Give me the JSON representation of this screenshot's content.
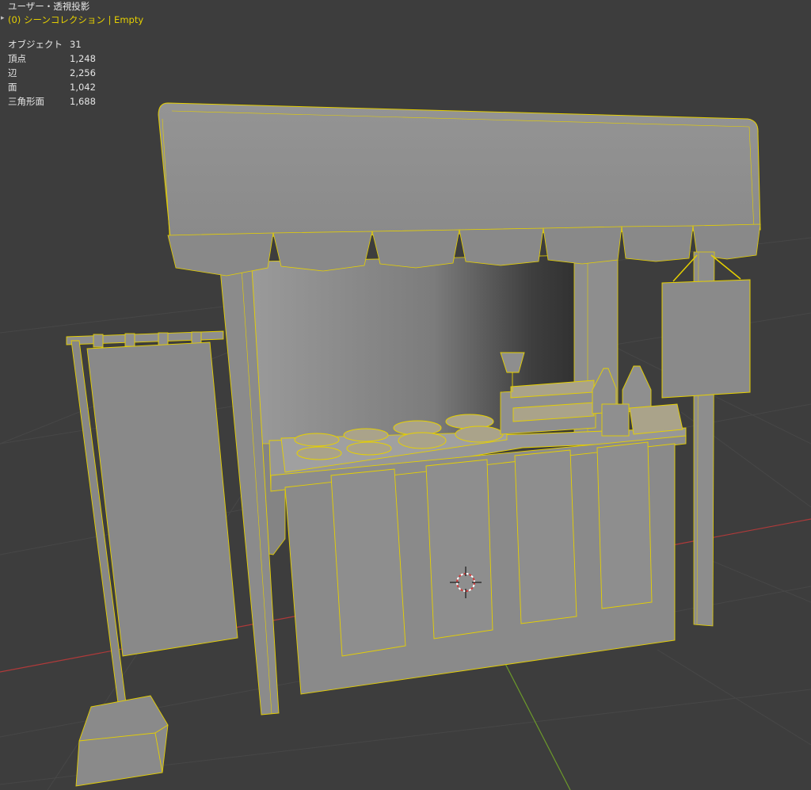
{
  "viewport": {
    "view_name": "ユーザー・透視投影",
    "collection_name": "(0) シーンコレクション | Empty"
  },
  "stats": [
    {
      "label": "オブジェクト",
      "value": "31"
    },
    {
      "label": "頂点",
      "value": "1,248"
    },
    {
      "label": "辺",
      "value": "2,256"
    },
    {
      "label": "面",
      "value": "1,042"
    },
    {
      "label": "三角形面",
      "value": "1,688"
    }
  ],
  "colors": {
    "background": "#3d3d3d",
    "selection_outline": "#e6d000",
    "grid_line": "#4a4a4a",
    "x_axis": "#b03a3a",
    "y_axis": "#6c9a2a"
  },
  "icons": {
    "expand": "chevron-right-icon",
    "cursor": "3d-cursor-icon"
  }
}
